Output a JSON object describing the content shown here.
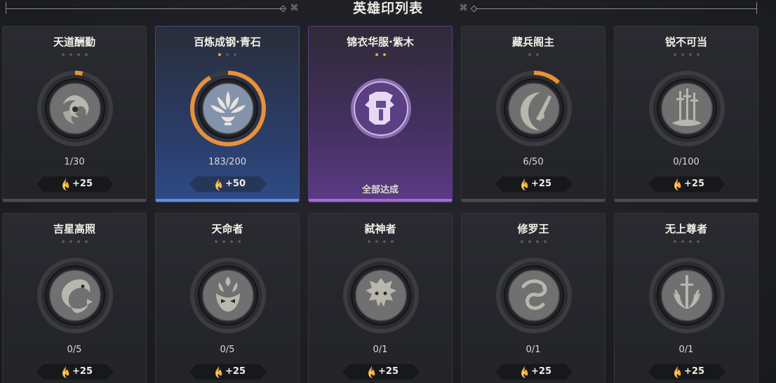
{
  "header": {
    "title": "英雄印列表"
  },
  "colors": {
    "accent_orange": "#e8913a",
    "star_on": "#e6a93c",
    "blue_card": "#2e4a86",
    "purple_card": "#5b3a86"
  },
  "cards": [
    {
      "name": "天道酬勤",
      "progress": "1/30",
      "reward": "+25",
      "stars_on": 0,
      "star_count": 4,
      "fill": 0.0333,
      "theme": "default",
      "emblem_icon": "swirl-icon"
    },
    {
      "name": "百炼成钢·青石",
      "progress": "183/200",
      "reward": "+50",
      "stars_on": 1,
      "star_count": 3,
      "fill": 0.915,
      "theme": "blue",
      "emblem_icon": "lotus-icon"
    },
    {
      "name": "锦衣华服·紫木",
      "progress": "全部达成",
      "reward": "",
      "stars_on": 2,
      "star_count": 2,
      "fill": 1,
      "theme": "purple",
      "emblem_icon": "robe-icon"
    },
    {
      "name": "藏兵阁主",
      "progress": "6/50",
      "reward": "+25",
      "stars_on": 0,
      "star_count": 2,
      "fill": 0.12,
      "theme": "default",
      "emblem_icon": "crescent-blade-icon"
    },
    {
      "name": "锐不可当",
      "progress": "0/100",
      "reward": "+25",
      "stars_on": 0,
      "star_count": 4,
      "fill": 0,
      "theme": "default",
      "emblem_icon": "swords-icon"
    },
    {
      "name": "吉星高照",
      "progress": "0/5",
      "reward": "+25",
      "stars_on": 0,
      "star_count": 4,
      "fill": 0,
      "theme": "default",
      "emblem_icon": "koi-icon"
    },
    {
      "name": "天命者",
      "progress": "0/5",
      "reward": "+25",
      "stars_on": 0,
      "star_count": 4,
      "fill": 0,
      "theme": "default",
      "emblem_icon": "flame-mask-icon"
    },
    {
      "name": "弑神者",
      "progress": "0/1",
      "reward": "+25",
      "stars_on": 0,
      "star_count": 4,
      "fill": 0,
      "theme": "default",
      "emblem_icon": "dragon-head-icon"
    },
    {
      "name": "修罗王",
      "progress": "0/1",
      "reward": "+25",
      "stars_on": 0,
      "star_count": 4,
      "fill": 0,
      "theme": "default",
      "emblem_icon": "serpent-icon"
    },
    {
      "name": "无上尊者",
      "progress": "0/1",
      "reward": "+25",
      "stars_on": 0,
      "star_count": 4,
      "fill": 0,
      "theme": "default",
      "emblem_icon": "laurel-sword-icon"
    }
  ]
}
